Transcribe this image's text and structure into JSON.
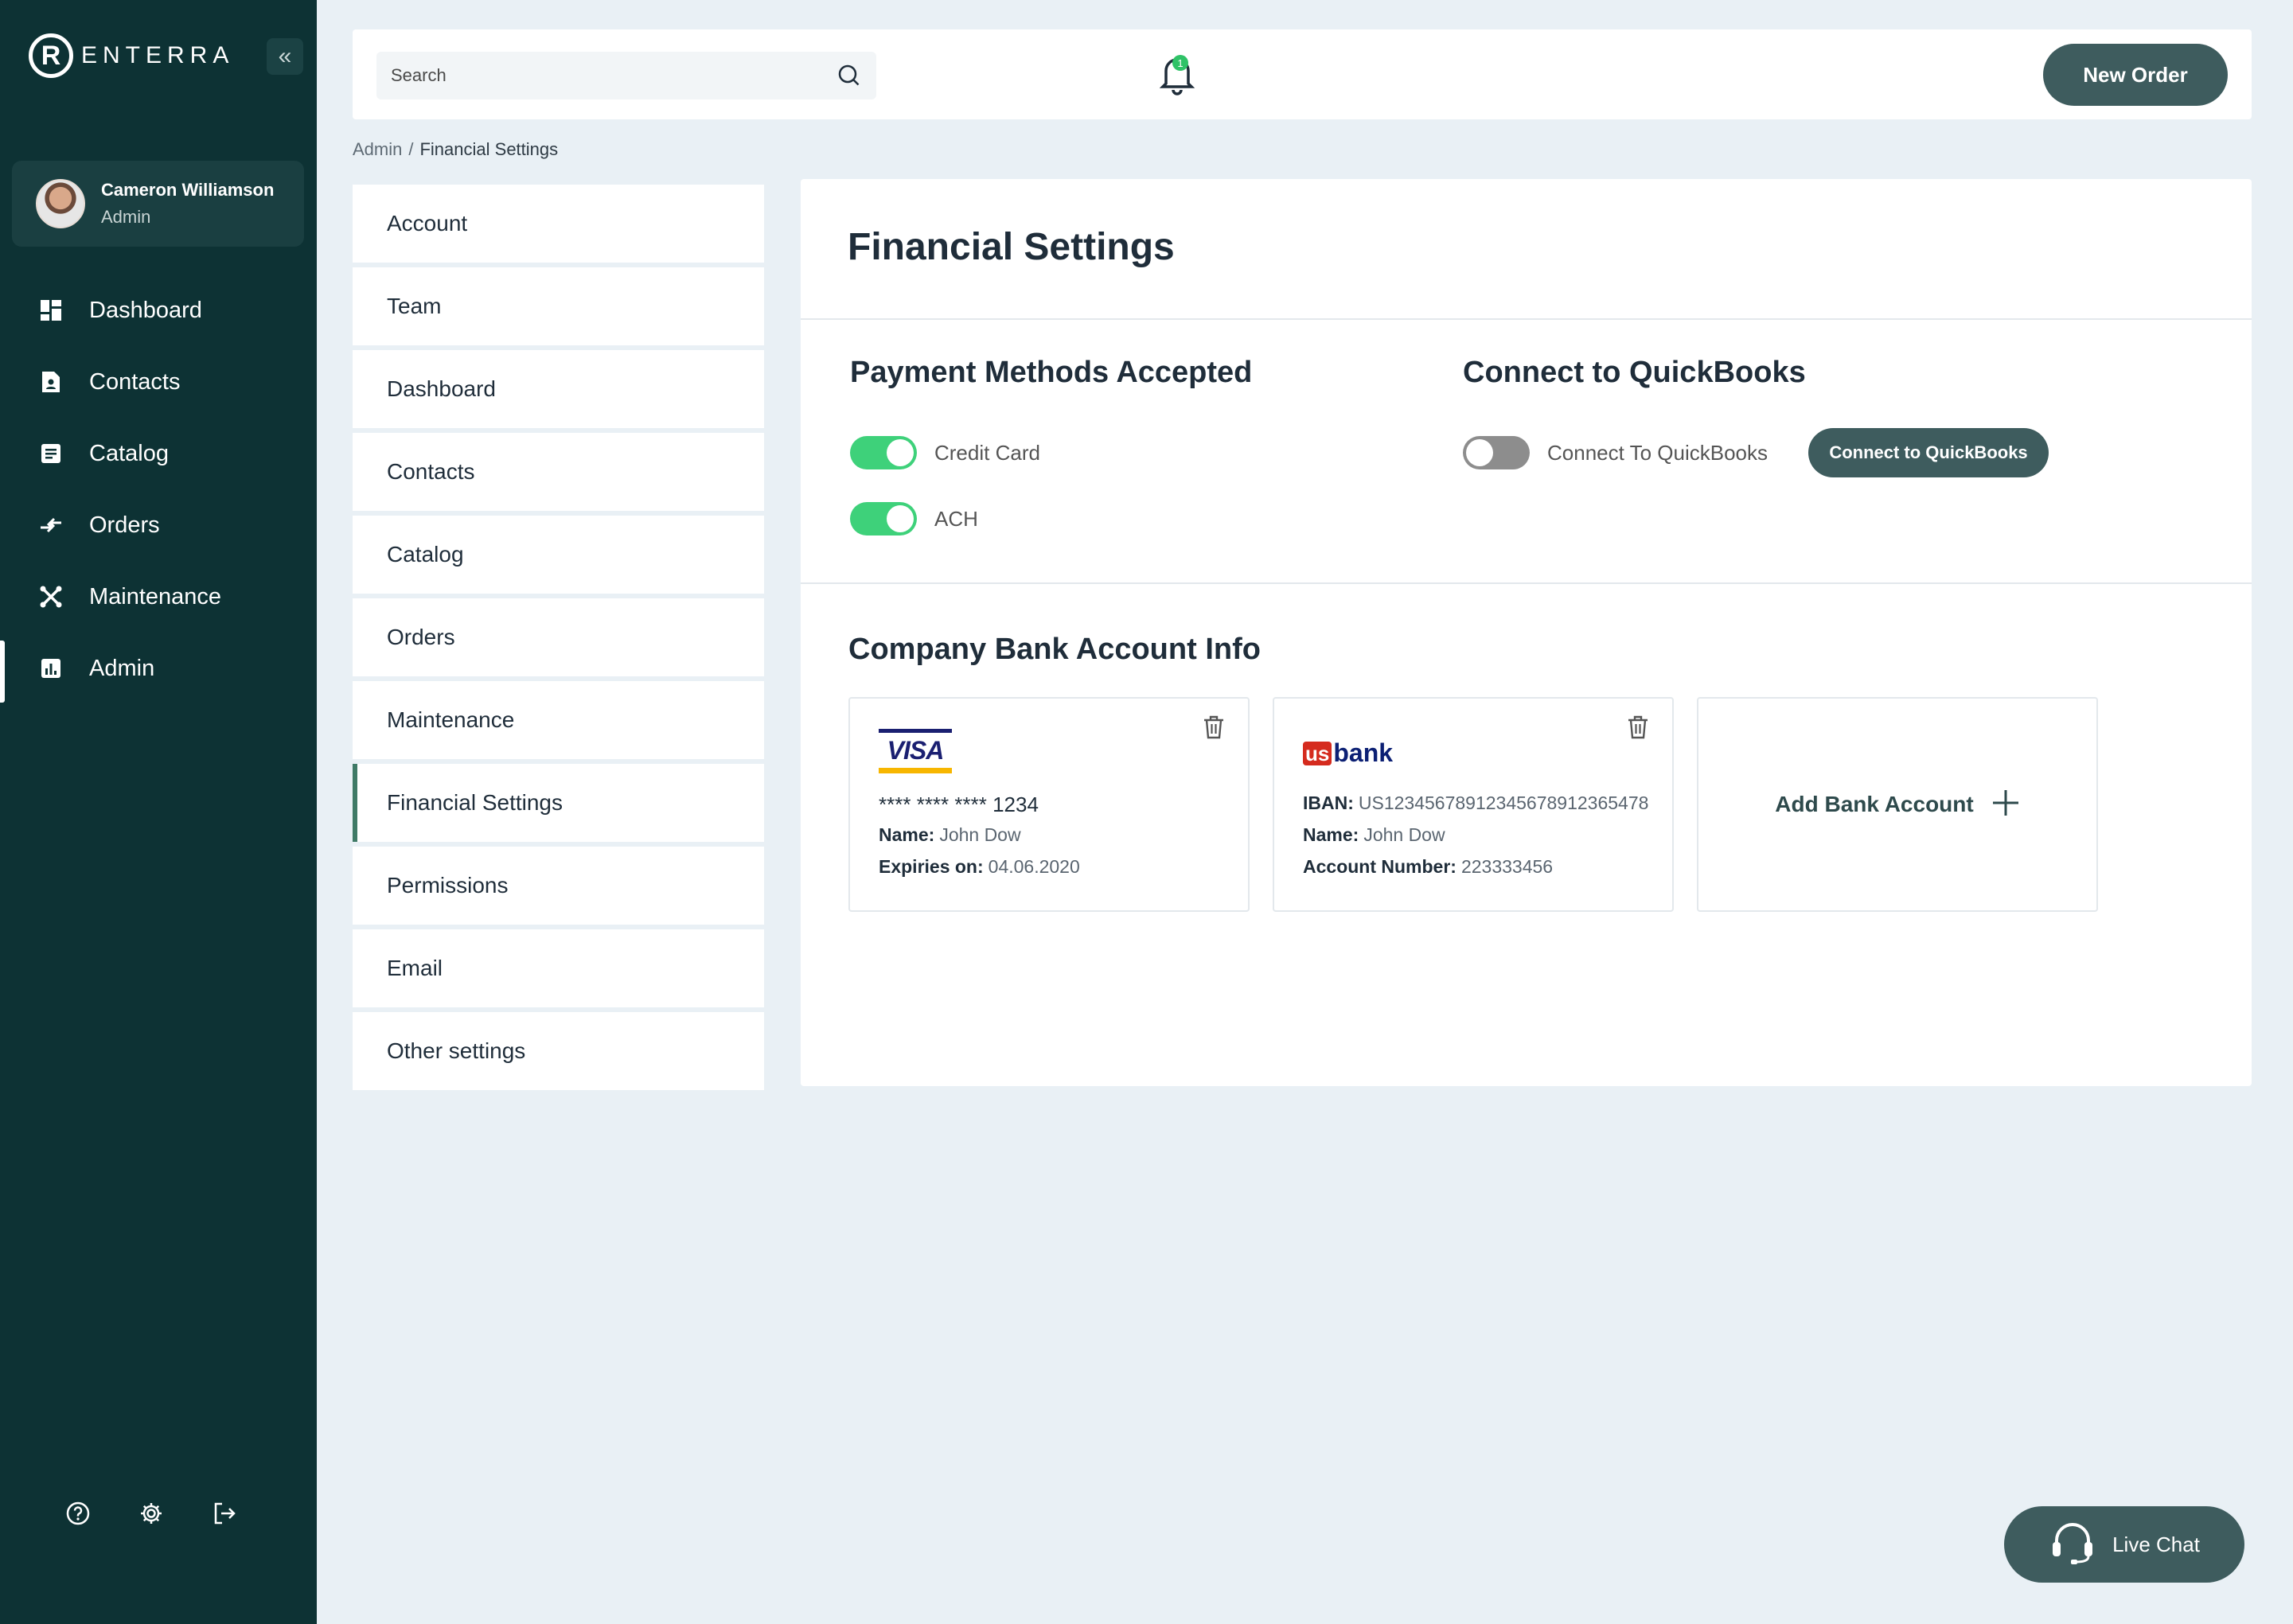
{
  "app": {
    "logo_letter": "R",
    "logo_text": "ENTERRA",
    "collapse_glyph": "«"
  },
  "profile": {
    "name": "Cameron Williamson",
    "role": "Admin"
  },
  "nav": {
    "items": [
      {
        "label": "Dashboard",
        "icon": "dashboard-icon"
      },
      {
        "label": "Contacts",
        "icon": "contacts-icon"
      },
      {
        "label": "Catalog",
        "icon": "catalog-icon"
      },
      {
        "label": "Orders",
        "icon": "orders-icon"
      },
      {
        "label": "Maintenance",
        "icon": "maintenance-icon"
      },
      {
        "label": "Admin",
        "icon": "admin-icon",
        "active": true
      }
    ]
  },
  "topbar": {
    "search_placeholder": "Search",
    "notification_count": "1",
    "new_order_label": "New Order"
  },
  "breadcrumb": {
    "root": "Admin",
    "separator": "/",
    "current": "Financial Settings"
  },
  "settings_menu": {
    "items": [
      "Account",
      "Team",
      "Dashboard",
      "Contacts",
      "Catalog",
      "Orders",
      "Maintenance",
      "Financial Settings",
      "Permissions",
      "Email",
      "Other settings"
    ],
    "active_index": 7
  },
  "panel": {
    "title": "Financial Settings",
    "payment": {
      "title": "Payment Methods Accepted",
      "credit_card_label": "Credit Card",
      "credit_card_on": true,
      "ach_label": "ACH",
      "ach_on": true
    },
    "quickbooks": {
      "title": "Connect to QuickBooks",
      "toggle_label": "Connect To QuickBooks",
      "toggle_on": false,
      "button_label": "Connect to QuickBooks"
    },
    "bank": {
      "title": "Company Bank Account Info",
      "visa_card": {
        "brand": "VISA",
        "number": "**** **** **** 1234",
        "name_label": "Name:",
        "name_value": "John Dow",
        "expiry_label": "Expiries on:",
        "expiry_value": "04.06.2020"
      },
      "usbank_card": {
        "brand_us": "us",
        "brand_bank": "bank",
        "iban_label": "IBAN:",
        "iban_value": "US12345678912345678912365478",
        "name_label": "Name:",
        "name_value": "John Dow",
        "account_label": "Account Number:",
        "account_value": "223333456"
      },
      "add_label": "Add Bank Account"
    }
  },
  "live_chat": {
    "label": "Live Chat"
  },
  "colors": {
    "sidebar_bg": "#0d3234",
    "primary_button": "#3e5c5e",
    "toggle_on": "#3ed17a",
    "toggle_off": "#8d8d8d",
    "active_accent": "#3f7a66",
    "page_bg": "#e9f0f5"
  }
}
